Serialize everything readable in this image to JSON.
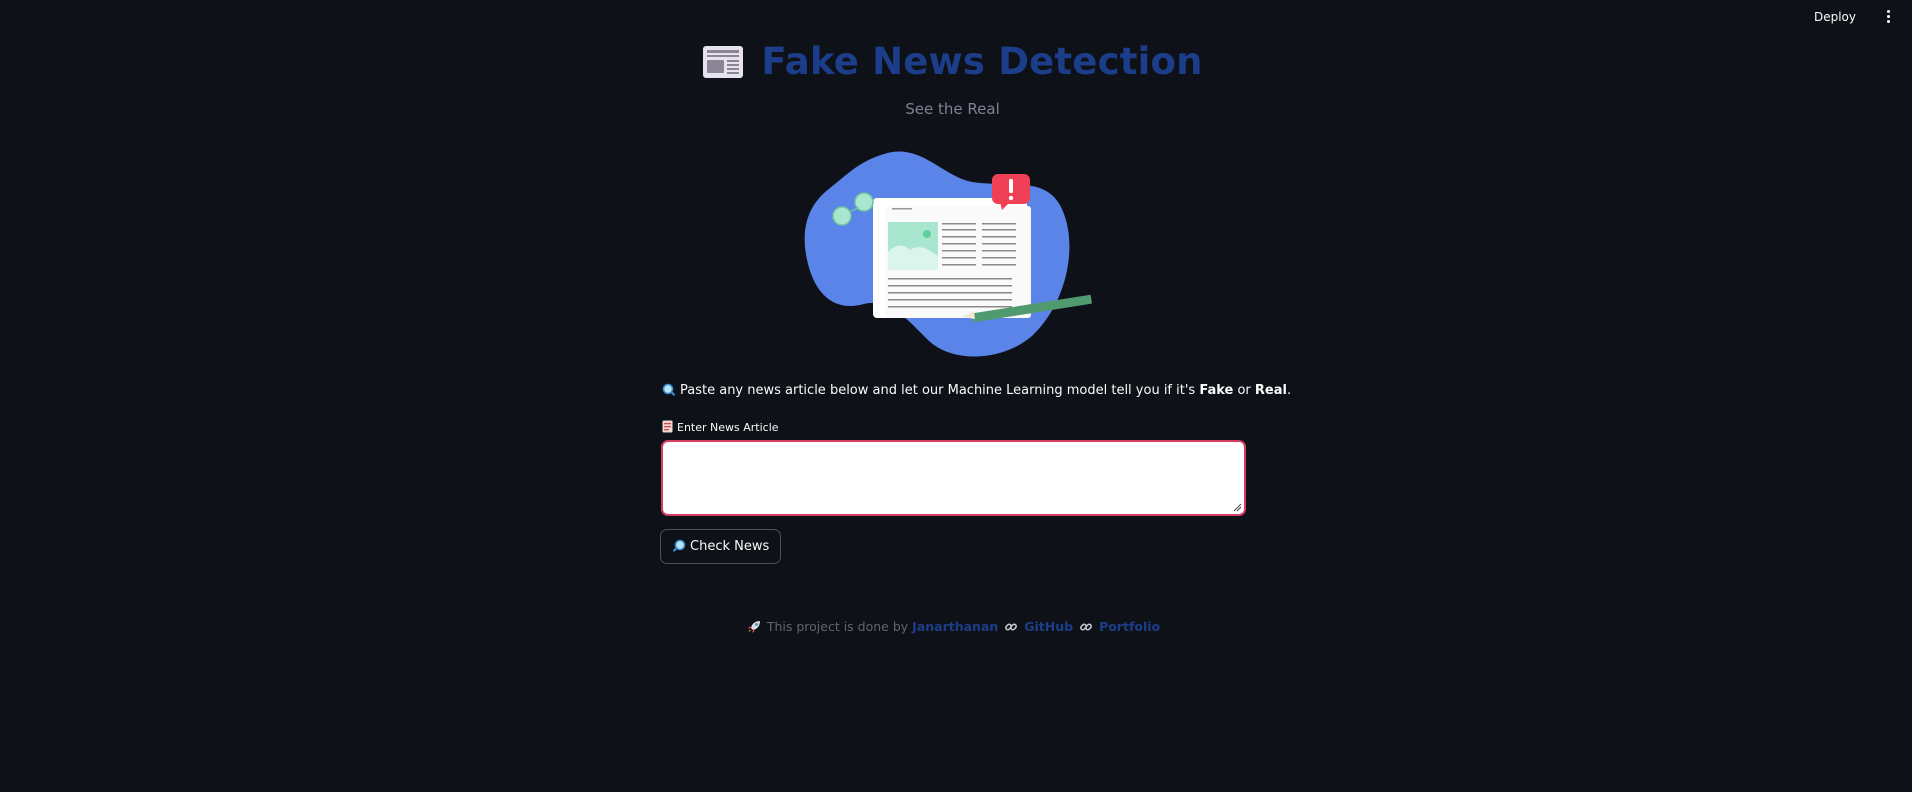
{
  "header": {
    "deploy_label": "Deploy",
    "menu_icon": "vertical-dots-icon"
  },
  "main": {
    "title": "Fake News Detection",
    "title_icon": "newspaper-icon",
    "subtitle": "See the Real",
    "hero_image": "news-article-alert-illustration",
    "intro": {
      "icon": "magnifier-icon",
      "prefix": "Paste any news article below and let our Machine Learning model tell you if it's ",
      "fake": "Fake",
      "or": " or ",
      "real": "Real",
      "suffix": "."
    },
    "input": {
      "label": "Enter News Article",
      "label_icon": "document-icon",
      "value": "",
      "placeholder": ""
    },
    "check_button": {
      "label": "Check News",
      "icon": "magnifier-icon"
    }
  },
  "footer": {
    "icon": "rocket-icon",
    "text": "This project is done by",
    "author": "Janarthanan",
    "github": "GitHub",
    "portfolio": "Portfolio",
    "link_icon": "link-icon"
  },
  "colors": {
    "background": "#0e1117",
    "title": "#1c3e8a",
    "input_border": "#d63d63",
    "blob": "#5b84e8",
    "alert": "#ef4056",
    "accent_green": "#a8e6cf"
  }
}
